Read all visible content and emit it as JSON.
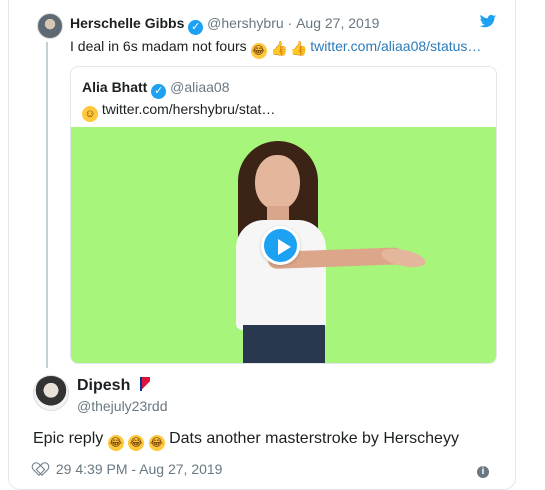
{
  "quoted_tweet": {
    "author_name": "Herschelle Gibbs",
    "handle": "@hershybru",
    "date": "Aug 27, 2019",
    "text": "I deal in 6s madam not fours",
    "link": "twitter.com/aliaa08/status…",
    "inner_tweet": {
      "author_name": "Alia Bhatt",
      "handle": "@aliaa08",
      "link": "twitter.com/hershybru/stat…",
      "media_color": "#a7f57a"
    }
  },
  "reply": {
    "author_name": "Dipesh",
    "handle": "@thejuly23rdd",
    "text_prefix": "Epic reply",
    "text_suffix": "Dats another masterstroke by Herscheyy",
    "likes": "29",
    "time": "4:39 PM - Aug 27, 2019"
  },
  "icons": {
    "twitter": "twitter-bird-icon",
    "verified": "verified-badge-icon",
    "laughing": "rolling-on-floor-laughing-emoji",
    "thumbs_up": "thumbs-up-emoji",
    "smile": "smiling-emoji",
    "heart": "heart-icon",
    "info": "info-icon",
    "flag": "nepal-flag-icon"
  },
  "colors": {
    "twitter_blue": "#1da1f2",
    "link_blue": "#2b7bb9",
    "muted_text": "#697882"
  }
}
